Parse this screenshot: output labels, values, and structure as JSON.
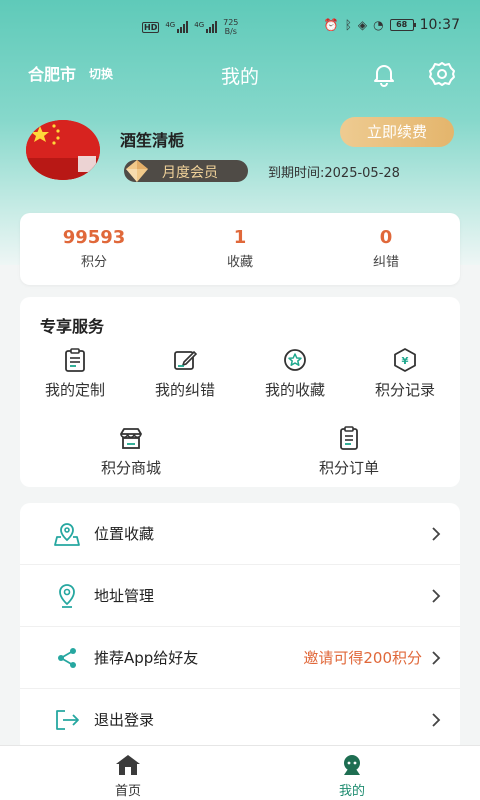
{
  "status_bar": {
    "hd_label": "HD",
    "network_1": "4G",
    "network_2": "4G",
    "speed_value": "725",
    "speed_unit": "B/s",
    "battery": "68",
    "time": "10:37"
  },
  "header": {
    "city": "合肥市",
    "switch_label": "切换",
    "title": "我的",
    "icons": [
      "bell-icon",
      "gear-icon"
    ]
  },
  "profile": {
    "username": "酒笙清栀",
    "membership": "月度会员",
    "expiry": "到期时间:2025-05-28",
    "renew_button": "立即续费"
  },
  "stats": [
    {
      "value": "99593",
      "label": "积分"
    },
    {
      "value": "1",
      "label": "收藏"
    },
    {
      "value": "0",
      "label": "纠错"
    }
  ],
  "services": {
    "title": "专享服务",
    "items": [
      {
        "label": "我的定制",
        "icon": "clipboard-icon"
      },
      {
        "label": "我的纠错",
        "icon": "edit-icon"
      },
      {
        "label": "我的收藏",
        "icon": "star-badge-icon"
      },
      {
        "label": "积分记录",
        "icon": "yen-hexagon-icon"
      },
      {
        "label": "积分商城",
        "icon": "store-icon"
      },
      {
        "label": "积分订单",
        "icon": "order-list-icon"
      }
    ]
  },
  "menu": {
    "items": [
      {
        "label": "位置收藏",
        "extra": "",
        "icon": "map-pin-icon"
      },
      {
        "label": "地址管理",
        "extra": "",
        "icon": "location-icon"
      },
      {
        "label": "推荐App给好友",
        "extra": "邀请可得200积分",
        "icon": "share-icon"
      },
      {
        "label": "退出登录",
        "extra": "",
        "icon": "logout-icon"
      }
    ]
  },
  "tabbar": {
    "items": [
      {
        "label": "首页",
        "icon": "home-icon",
        "active": false
      },
      {
        "label": "我的",
        "icon": "profile-icon",
        "active": true
      }
    ]
  },
  "colors": {
    "brand": "#5fcab9",
    "accent_orange": "#e0683a",
    "gold": "#e4b56c",
    "tab_active": "#1e8c70"
  }
}
